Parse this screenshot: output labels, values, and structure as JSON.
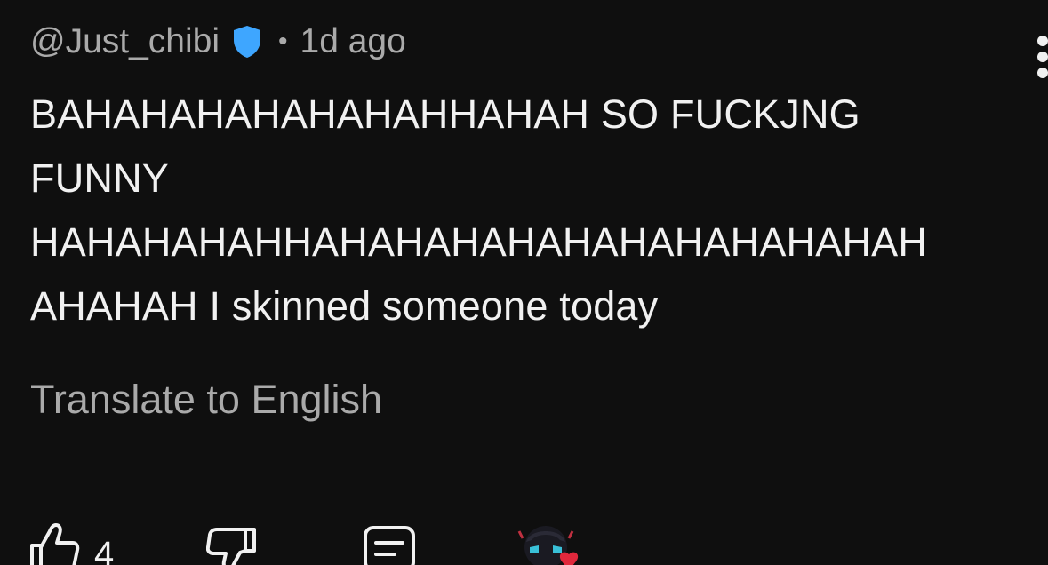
{
  "comment": {
    "author": "@Just_chibi",
    "separator": "•",
    "timestamp": "1d ago",
    "body": "BAHAHAHAHAHAHAHHAHAH SO FUCKJNG\nFUNNY\nHAHAHAHAHHAHAHAHAHAHAHAHAHAHAHAH\nAHAHAH I skinned someone today",
    "translate_label": "Translate to English",
    "like_count": "4"
  },
  "icons": {
    "verified": "verified-shield-icon",
    "menu": "more-vertical-icon",
    "like": "thumbs-up-icon",
    "dislike": "thumbs-down-icon",
    "reply": "reply-comment-icon",
    "creator_heart": "creator-heart-avatar-icon"
  },
  "colors": {
    "background": "#0f0f0f",
    "primary_text": "#f1f1f1",
    "secondary_text": "#aaaaaa",
    "verified_badge": "#3ea6ff",
    "heart": "#e0283c"
  }
}
